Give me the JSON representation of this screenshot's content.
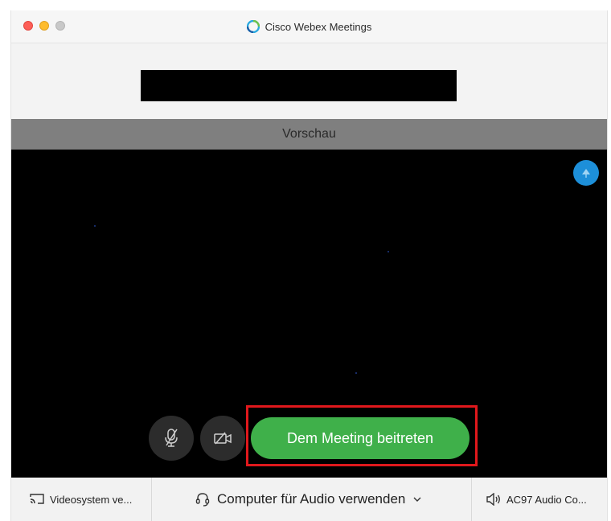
{
  "window": {
    "title": "Cisco Webex Meetings",
    "app_icon": "webex-logo-icon"
  },
  "preview": {
    "label": "Vorschau"
  },
  "controls": {
    "mute_icon": "microphone-muted-icon",
    "video_icon": "video-off-icon",
    "share_icon": "share-screen-icon",
    "join_label": "Dem Meeting beitreten"
  },
  "bottom_bar": {
    "video_system_label": "Videosystem ve...",
    "video_system_icon": "cast-icon",
    "audio_label": "Computer für Audio verwenden",
    "audio_icon": "headset-icon",
    "speaker_label": "AC97 Audio Co...",
    "speaker_icon": "speaker-icon"
  },
  "colors": {
    "join_button": "#3fb04a",
    "highlight_box": "#e0181c",
    "share_button": "#1d8fd9",
    "preview_bar": "#7f7f7f",
    "video_area": "#000000"
  }
}
